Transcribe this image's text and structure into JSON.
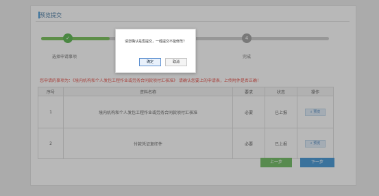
{
  "header": {
    "title": "预览提交"
  },
  "steps": {
    "items": [
      {
        "label": "选择申请事项",
        "icon": "check",
        "number": ""
      },
      {
        "label": "完成",
        "icon": "",
        "number": "4"
      }
    ]
  },
  "notice": "您申请的事项为：《境内机构和个人发包工程作业或劳务合同款项付汇核准》 请确认您要上的申请表，上传附件是否正确！",
  "table": {
    "headers": [
      "序号",
      "资料名称",
      "要求",
      "状态",
      "操作"
    ],
    "rows": [
      {
        "index": "1",
        "name": "境内机构和个人发包工程作业或劳务合同款项付汇核准",
        "requirement": "必要",
        "status": "已上报",
        "action": "预览"
      },
      {
        "index": "2",
        "name": "付款凭证复印件",
        "requirement": "必要",
        "status": "已上报",
        "action": "预览"
      }
    ]
  },
  "buttons": {
    "prev": "上一步",
    "next": "下一步"
  },
  "dialog": {
    "message": "请您确认是否提交，一经提交不能修改？",
    "ok": "确定",
    "cancel": "取消"
  },
  "colors": {
    "accent": "#3a8fd0",
    "success": "#52b045",
    "warning": "#e0423a"
  }
}
